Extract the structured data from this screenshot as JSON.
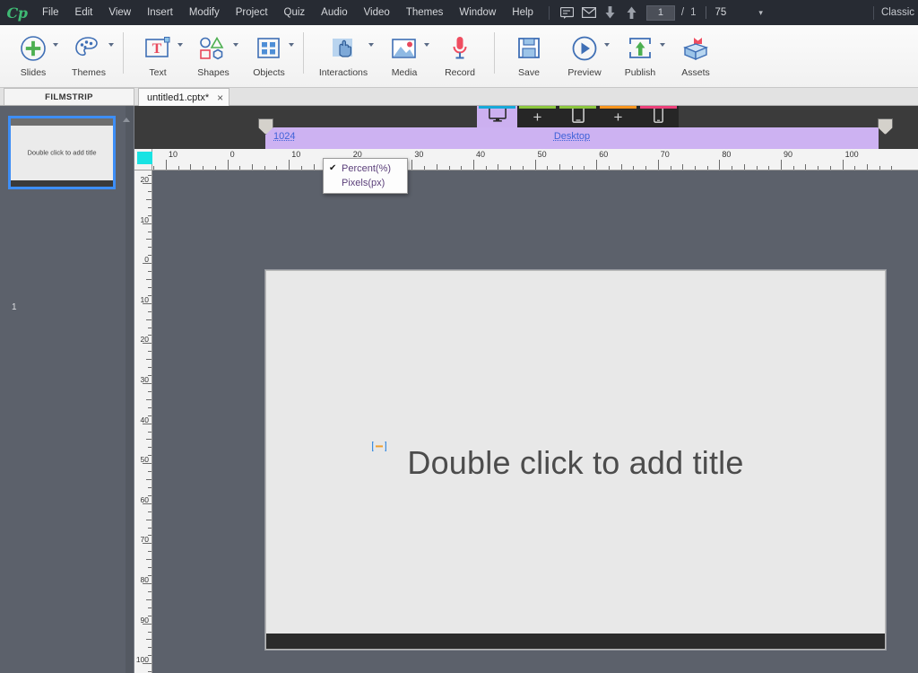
{
  "app": {
    "logo": "Cp",
    "workspace": "Classic"
  },
  "menubar": {
    "items": [
      {
        "label": "File"
      },
      {
        "label": "Edit"
      },
      {
        "label": "View"
      },
      {
        "label": "Insert"
      },
      {
        "label": "Modify"
      },
      {
        "label": "Project"
      },
      {
        "label": "Quiz"
      },
      {
        "label": "Audio"
      },
      {
        "label": "Video"
      },
      {
        "label": "Themes"
      },
      {
        "label": "Window"
      },
      {
        "label": "Help"
      }
    ],
    "icons": [
      {
        "name": "comments-icon"
      },
      {
        "name": "email-icon"
      },
      {
        "name": "download-arrow-icon"
      },
      {
        "name": "upload-arrow-icon"
      }
    ],
    "current_slide": "1",
    "separator": "/",
    "total_slides": "1",
    "zoom_value": "75",
    "zoom_caret": "▾"
  },
  "ribbon": {
    "buttons": [
      {
        "label": "Slides",
        "icon": "plus-circle-icon",
        "caret": true
      },
      {
        "label": "Themes",
        "icon": "palette-icon",
        "caret": true
      },
      {
        "label": "Text",
        "icon": "text-box-icon",
        "caret": true
      },
      {
        "label": "Shapes",
        "icon": "shapes-icon",
        "caret": true
      },
      {
        "label": "Objects",
        "icon": "objects-grid-icon",
        "caret": true
      },
      {
        "label": "Interactions",
        "icon": "hand-click-icon",
        "caret": true
      },
      {
        "label": "Media",
        "icon": "media-image-icon",
        "caret": true
      },
      {
        "label": "Record",
        "icon": "microphone-icon",
        "caret": false
      },
      {
        "label": "Save",
        "icon": "floppy-save-icon",
        "caret": false
      },
      {
        "label": "Preview",
        "icon": "play-circle-icon",
        "caret": true
      },
      {
        "label": "Publish",
        "icon": "publish-up-icon",
        "caret": true
      },
      {
        "label": "Assets",
        "icon": "assets-box-icon",
        "caret": false
      }
    ]
  },
  "tabs": {
    "filmstrip_label": "FILMSTRIP",
    "document_tab": "untitled1.cptx*",
    "document_close": "×"
  },
  "filmstrip": {
    "slides": [
      {
        "number": "1",
        "text": "Double click to add title"
      }
    ]
  },
  "devicebar": {
    "tabs": [
      {
        "icon": "desktop-monitor-icon",
        "label": "",
        "accent": "#18a8d8",
        "active": true
      },
      {
        "icon": "add-breakpoint-icon",
        "label": "+",
        "accent": "#8cc63e",
        "active": false
      },
      {
        "icon": "tablet-icon",
        "label": "",
        "accent": "#8cc63e",
        "active": false
      },
      {
        "icon": "add-breakpoint-icon",
        "label": "+",
        "accent": "#f7941e",
        "active": false
      },
      {
        "icon": "mobile-phone-icon",
        "label": "",
        "accent": "#ec407a",
        "active": false
      }
    ]
  },
  "breakpoint": {
    "width_label": "1024",
    "name": "Desktop",
    "bar_color": "#cdb2f2"
  },
  "rulers": {
    "unit": "percent",
    "horizontal_labels": [
      "10",
      "0",
      "10",
      "20",
      "30",
      "40",
      "50",
      "60",
      "70",
      "80",
      "90",
      "100"
    ],
    "vertical_labels": [
      "20",
      "10",
      "0",
      "10",
      "20",
      "30",
      "40",
      "50",
      "60",
      "70",
      "80",
      "90",
      "100"
    ]
  },
  "dropdown": {
    "items": [
      {
        "label": "Percent(%)",
        "checked": true,
        "check": "✔"
      },
      {
        "label": "Pixels(px)",
        "checked": false,
        "check": ""
      }
    ]
  },
  "canvas": {
    "title_placeholder": "Double click to add title",
    "slide_bg": "#e8e8e8",
    "footer_color": "#2b2b2b"
  }
}
